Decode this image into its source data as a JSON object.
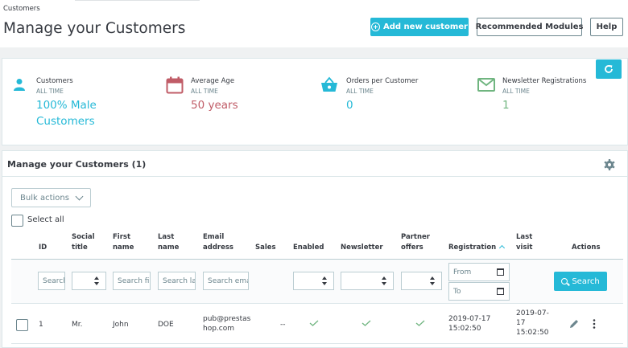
{
  "breadcrumb": "Customers",
  "page_title": "Manage your Customers",
  "toolbar": {
    "add_label": "Add new customer",
    "recommended_label": "Recommended Modules",
    "help_label": "Help"
  },
  "colors": {
    "accent": "#25b9d7",
    "kpi_red": "#c05c67",
    "kpi_green": "#70b580",
    "text": "#363a41"
  },
  "kpis": [
    {
      "icon": "person-icon",
      "title": "Customers",
      "sub": "ALL TIME",
      "value_line1": "100% Male",
      "value_line2": "Customers",
      "color": "#25b9d7"
    },
    {
      "icon": "calendar-icon",
      "title": "Average Age",
      "sub": "ALL TIME",
      "value_line1": "50 years",
      "color": "#c05c67"
    },
    {
      "icon": "basket-icon",
      "title": "Orders per Customer",
      "sub": "ALL TIME",
      "value_line1": "0",
      "color": "#25b9d7"
    },
    {
      "icon": "envelope-icon",
      "title": "Newsletter Registrations",
      "sub": "ALL TIME",
      "value_line1": "1",
      "color": "#70b580"
    }
  ],
  "table": {
    "title": "Manage your Customers (1)",
    "bulk_actions": "Bulk actions",
    "select_all": "Select all",
    "headers": {
      "id": "ID",
      "social_title": [
        "Social",
        "title"
      ],
      "first_name": [
        "First",
        "name"
      ],
      "last_name": [
        "Last",
        "name"
      ],
      "email": [
        "Email",
        "address"
      ],
      "sales": "Sales",
      "enabled": "Enabled",
      "newsletter": "Newsletter",
      "partner": [
        "Partner",
        "offers"
      ],
      "registration": "Registration",
      "last_visit": [
        "Last",
        "visit"
      ],
      "actions": "Actions"
    },
    "filters": {
      "id_placeholder": "Search ID",
      "first_name_placeholder": "Search first name",
      "last_name_placeholder": "Search last name",
      "email_placeholder": "Search email",
      "from_placeholder": "From",
      "to_placeholder": "To",
      "search_label": "Search"
    },
    "rows": [
      {
        "id": "1",
        "social_title": "Mr.",
        "first_name": "John",
        "last_name": "DOE",
        "email_line1": "pub@prestas",
        "email_line2": "hop.com",
        "sales": "--",
        "enabled": true,
        "newsletter": true,
        "partner": true,
        "registration_date": "2019-07-17",
        "registration_time": "15:02:50",
        "last_visit_line1": "2019-07-",
        "last_visit_line2": "17",
        "last_visit_line3": "15:02:50"
      }
    ]
  }
}
